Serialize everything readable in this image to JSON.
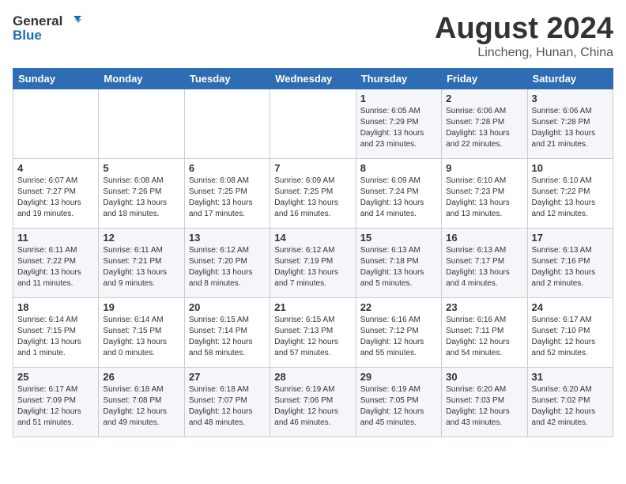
{
  "header": {
    "logo_general": "General",
    "logo_blue": "Blue",
    "month_year": "August 2024",
    "location": "Lincheng, Hunan, China"
  },
  "weekdays": [
    "Sunday",
    "Monday",
    "Tuesday",
    "Wednesday",
    "Thursday",
    "Friday",
    "Saturday"
  ],
  "weeks": [
    [
      {
        "day": "",
        "sunrise": "",
        "sunset": "",
        "daylight": ""
      },
      {
        "day": "",
        "sunrise": "",
        "sunset": "",
        "daylight": ""
      },
      {
        "day": "",
        "sunrise": "",
        "sunset": "",
        "daylight": ""
      },
      {
        "day": "",
        "sunrise": "",
        "sunset": "",
        "daylight": ""
      },
      {
        "day": "1",
        "sunrise": "Sunrise: 6:05 AM",
        "sunset": "Sunset: 7:29 PM",
        "daylight": "Daylight: 13 hours and 23 minutes."
      },
      {
        "day": "2",
        "sunrise": "Sunrise: 6:06 AM",
        "sunset": "Sunset: 7:28 PM",
        "daylight": "Daylight: 13 hours and 22 minutes."
      },
      {
        "day": "3",
        "sunrise": "Sunrise: 6:06 AM",
        "sunset": "Sunset: 7:28 PM",
        "daylight": "Daylight: 13 hours and 21 minutes."
      }
    ],
    [
      {
        "day": "4",
        "sunrise": "Sunrise: 6:07 AM",
        "sunset": "Sunset: 7:27 PM",
        "daylight": "Daylight: 13 hours and 19 minutes."
      },
      {
        "day": "5",
        "sunrise": "Sunrise: 6:08 AM",
        "sunset": "Sunset: 7:26 PM",
        "daylight": "Daylight: 13 hours and 18 minutes."
      },
      {
        "day": "6",
        "sunrise": "Sunrise: 6:08 AM",
        "sunset": "Sunset: 7:25 PM",
        "daylight": "Daylight: 13 hours and 17 minutes."
      },
      {
        "day": "7",
        "sunrise": "Sunrise: 6:09 AM",
        "sunset": "Sunset: 7:25 PM",
        "daylight": "Daylight: 13 hours and 16 minutes."
      },
      {
        "day": "8",
        "sunrise": "Sunrise: 6:09 AM",
        "sunset": "Sunset: 7:24 PM",
        "daylight": "Daylight: 13 hours and 14 minutes."
      },
      {
        "day": "9",
        "sunrise": "Sunrise: 6:10 AM",
        "sunset": "Sunset: 7:23 PM",
        "daylight": "Daylight: 13 hours and 13 minutes."
      },
      {
        "day": "10",
        "sunrise": "Sunrise: 6:10 AM",
        "sunset": "Sunset: 7:22 PM",
        "daylight": "Daylight: 13 hours and 12 minutes."
      }
    ],
    [
      {
        "day": "11",
        "sunrise": "Sunrise: 6:11 AM",
        "sunset": "Sunset: 7:22 PM",
        "daylight": "Daylight: 13 hours and 11 minutes."
      },
      {
        "day": "12",
        "sunrise": "Sunrise: 6:11 AM",
        "sunset": "Sunset: 7:21 PM",
        "daylight": "Daylight: 13 hours and 9 minutes."
      },
      {
        "day": "13",
        "sunrise": "Sunrise: 6:12 AM",
        "sunset": "Sunset: 7:20 PM",
        "daylight": "Daylight: 13 hours and 8 minutes."
      },
      {
        "day": "14",
        "sunrise": "Sunrise: 6:12 AM",
        "sunset": "Sunset: 7:19 PM",
        "daylight": "Daylight: 13 hours and 7 minutes."
      },
      {
        "day": "15",
        "sunrise": "Sunrise: 6:13 AM",
        "sunset": "Sunset: 7:18 PM",
        "daylight": "Daylight: 13 hours and 5 minutes."
      },
      {
        "day": "16",
        "sunrise": "Sunrise: 6:13 AM",
        "sunset": "Sunset: 7:17 PM",
        "daylight": "Daylight: 13 hours and 4 minutes."
      },
      {
        "day": "17",
        "sunrise": "Sunrise: 6:13 AM",
        "sunset": "Sunset: 7:16 PM",
        "daylight": "Daylight: 13 hours and 2 minutes."
      }
    ],
    [
      {
        "day": "18",
        "sunrise": "Sunrise: 6:14 AM",
        "sunset": "Sunset: 7:15 PM",
        "daylight": "Daylight: 13 hours and 1 minute."
      },
      {
        "day": "19",
        "sunrise": "Sunrise: 6:14 AM",
        "sunset": "Sunset: 7:15 PM",
        "daylight": "Daylight: 13 hours and 0 minutes."
      },
      {
        "day": "20",
        "sunrise": "Sunrise: 6:15 AM",
        "sunset": "Sunset: 7:14 PM",
        "daylight": "Daylight: 12 hours and 58 minutes."
      },
      {
        "day": "21",
        "sunrise": "Sunrise: 6:15 AM",
        "sunset": "Sunset: 7:13 PM",
        "daylight": "Daylight: 12 hours and 57 minutes."
      },
      {
        "day": "22",
        "sunrise": "Sunrise: 6:16 AM",
        "sunset": "Sunset: 7:12 PM",
        "daylight": "Daylight: 12 hours and 55 minutes."
      },
      {
        "day": "23",
        "sunrise": "Sunrise: 6:16 AM",
        "sunset": "Sunset: 7:11 PM",
        "daylight": "Daylight: 12 hours and 54 minutes."
      },
      {
        "day": "24",
        "sunrise": "Sunrise: 6:17 AM",
        "sunset": "Sunset: 7:10 PM",
        "daylight": "Daylight: 12 hours and 52 minutes."
      }
    ],
    [
      {
        "day": "25",
        "sunrise": "Sunrise: 6:17 AM",
        "sunset": "Sunset: 7:09 PM",
        "daylight": "Daylight: 12 hours and 51 minutes."
      },
      {
        "day": "26",
        "sunrise": "Sunrise: 6:18 AM",
        "sunset": "Sunset: 7:08 PM",
        "daylight": "Daylight: 12 hours and 49 minutes."
      },
      {
        "day": "27",
        "sunrise": "Sunrise: 6:18 AM",
        "sunset": "Sunset: 7:07 PM",
        "daylight": "Daylight: 12 hours and 48 minutes."
      },
      {
        "day": "28",
        "sunrise": "Sunrise: 6:19 AM",
        "sunset": "Sunset: 7:06 PM",
        "daylight": "Daylight: 12 hours and 46 minutes."
      },
      {
        "day": "29",
        "sunrise": "Sunrise: 6:19 AM",
        "sunset": "Sunset: 7:05 PM",
        "daylight": "Daylight: 12 hours and 45 minutes."
      },
      {
        "day": "30",
        "sunrise": "Sunrise: 6:20 AM",
        "sunset": "Sunset: 7:03 PM",
        "daylight": "Daylight: 12 hours and 43 minutes."
      },
      {
        "day": "31",
        "sunrise": "Sunrise: 6:20 AM",
        "sunset": "Sunset: 7:02 PM",
        "daylight": "Daylight: 12 hours and 42 minutes."
      }
    ]
  ]
}
